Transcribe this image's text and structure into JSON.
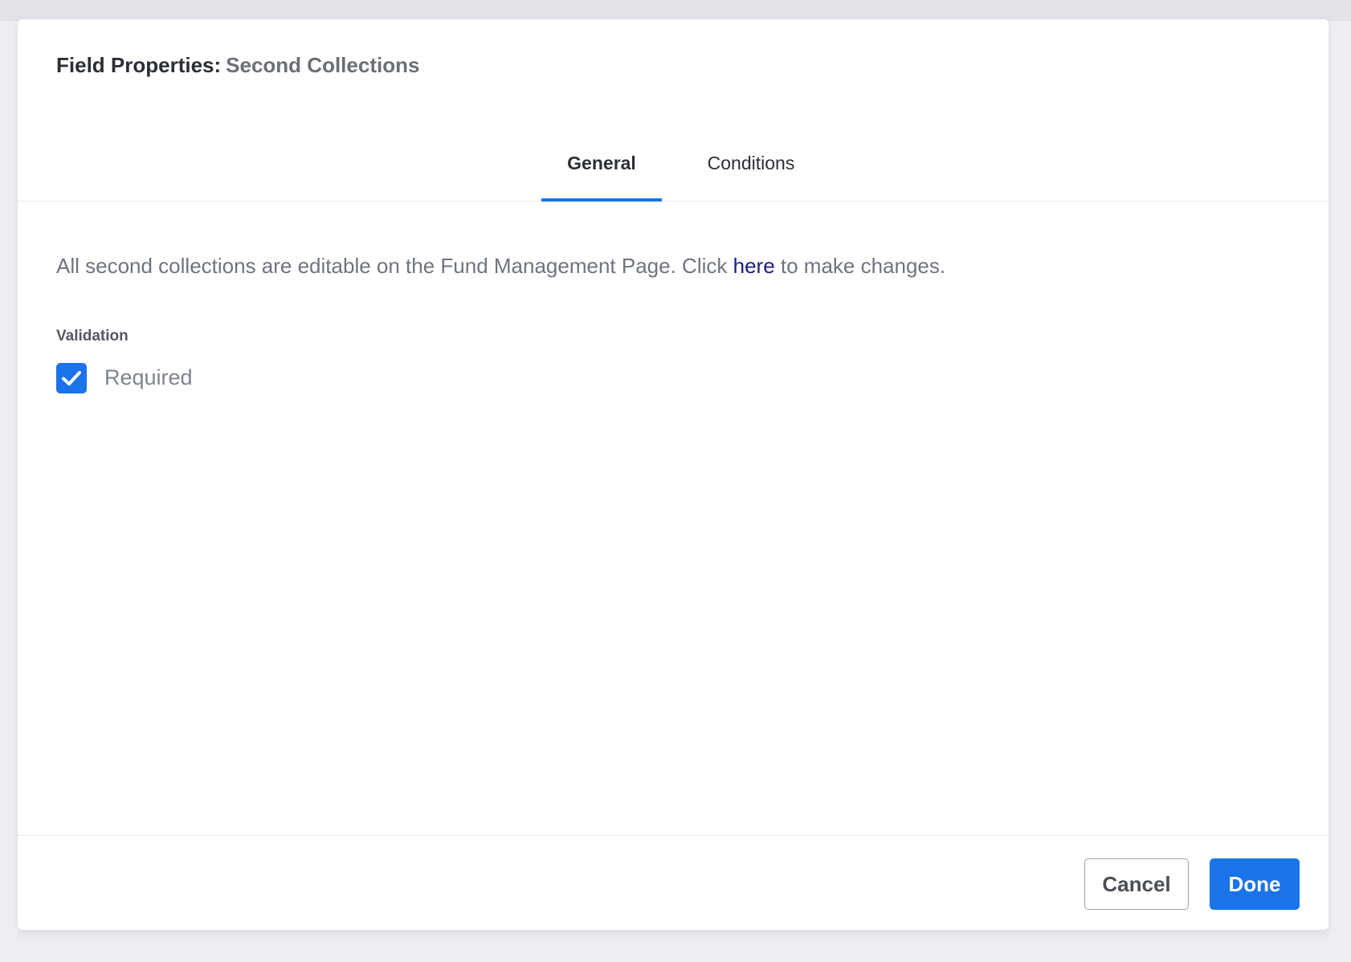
{
  "dialog": {
    "title_prefix": "Field Properties:",
    "title_subject": "Second Collections"
  },
  "tabs": [
    {
      "label": "General",
      "active": true
    },
    {
      "label": "Conditions",
      "active": false
    }
  ],
  "content": {
    "info_before": "All second collections are editable on the Fund Management Page. Click ",
    "info_link": "here",
    "info_after": " to make changes.",
    "validation_label": "Validation",
    "required_label": "Required",
    "required_checked": true
  },
  "footer": {
    "cancel_label": "Cancel",
    "done_label": "Done"
  },
  "colors": {
    "accent": "#1a73e8",
    "link": "#1a1f7a"
  },
  "icons": {
    "checkbox_mark": "checkmark-icon"
  }
}
